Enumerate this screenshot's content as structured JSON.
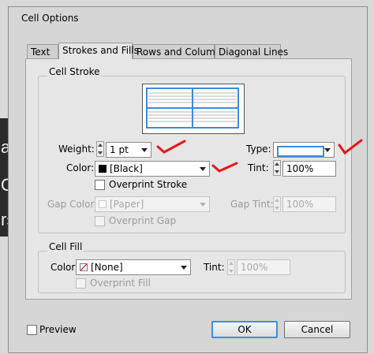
{
  "window": {
    "title": "Cell Options"
  },
  "background": {
    "letters": [
      "a",
      "O",
      "rs"
    ]
  },
  "tabs": [
    {
      "label": "Text"
    },
    {
      "label": "Strokes and Fills"
    },
    {
      "label": "Rows and Columns"
    },
    {
      "label": "Diagonal Lines"
    }
  ],
  "cell_stroke": {
    "title": "Cell Stroke",
    "weight_label": "Weight:",
    "weight_value": "1 pt",
    "type_label": "Type:",
    "color_label": "Color:",
    "color_value": "[Black]",
    "tint_label": "Tint:",
    "tint_value": "100%",
    "overprint_label": "Overprint Stroke",
    "gap_color_label": "Gap Color:",
    "gap_color_value": "[Paper]",
    "gap_tint_label": "Gap Tint:",
    "gap_tint_value": "100%",
    "overprint_gap_label": "Overprint Gap"
  },
  "cell_fill": {
    "title": "Cell Fill",
    "color_label": "Color:",
    "color_value": "[None]",
    "tint_label": "Tint:",
    "tint_value": "100%",
    "overprint_label": "Overprint Fill"
  },
  "footer": {
    "preview_label": "Preview",
    "ok_label": "OK",
    "cancel_label": "Cancel"
  },
  "colors": {
    "accent": "#3d8ee0",
    "annotation": "#e8151b",
    "stroke_line": "#3a8be0"
  },
  "icons": [
    "stroke-proxy-icon",
    "checkmark-annotation-icon",
    "dropdown-arrow-icon",
    "spinner-icon",
    "none-swatch-icon"
  ]
}
